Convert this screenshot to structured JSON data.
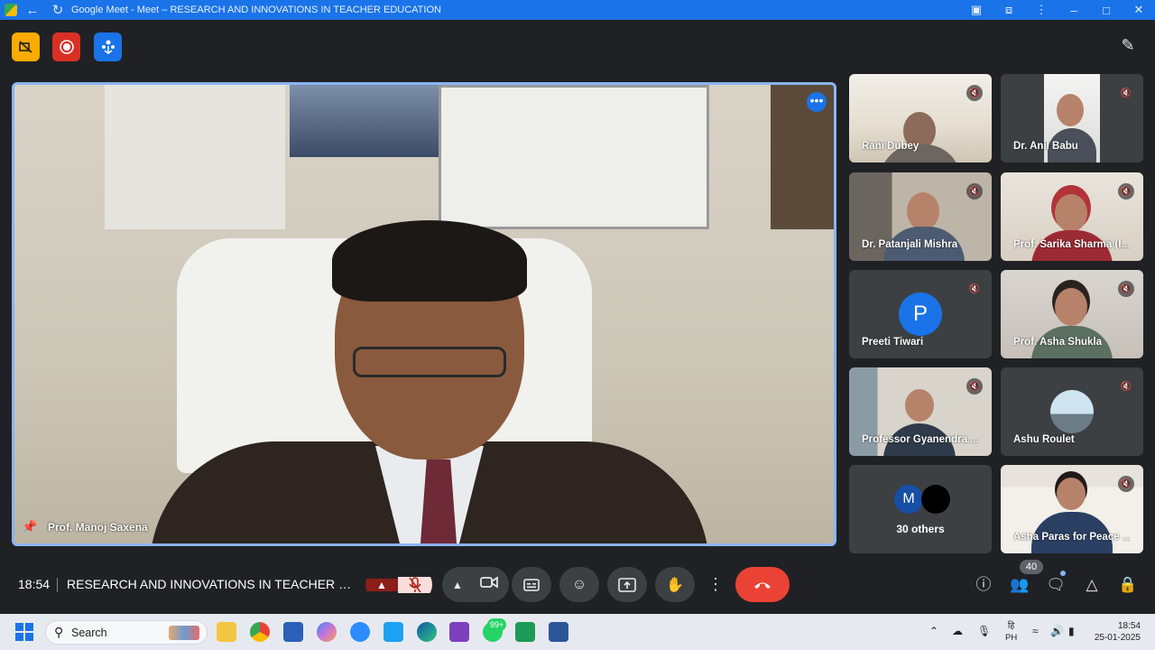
{
  "window": {
    "title": "Google Meet - Meet – RESEARCH AND INNOVATIONS IN TEACHER EDUCATION"
  },
  "main_speaker": {
    "name": "Prof. Manoj Saxena"
  },
  "participants": [
    {
      "name": "Rani Dubey"
    },
    {
      "name": "Dr. Anil Babu"
    },
    {
      "name": "Dr. Patanjali Mishra"
    },
    {
      "name": "Prof. Sarika Sharma (I..."
    },
    {
      "name": "Preeti Tiwari",
      "initial": "P"
    },
    {
      "name": "Prof. Asha Shukla"
    },
    {
      "name": "Professor Gyanendra ..."
    },
    {
      "name": "Ashu Roulet"
    },
    {
      "name": "30 others",
      "initial": "M"
    },
    {
      "name": "Asha Paras for Peace ..."
    }
  ],
  "bottom_bar": {
    "time": "18:54",
    "meeting_title": "RESEARCH AND INNOVATIONS IN TEACHER EDU...",
    "participant_count": "40"
  },
  "taskbar": {
    "search_placeholder": "Search",
    "whatsapp_badge": "99+",
    "lang_line1": "हि",
    "lang_line2": "PH",
    "time": "18:54",
    "date": "25-01-2025"
  },
  "colors": {
    "accent": "#1a73e8",
    "end_call": "#ea4335",
    "mic_muted": "#f9dedc"
  }
}
